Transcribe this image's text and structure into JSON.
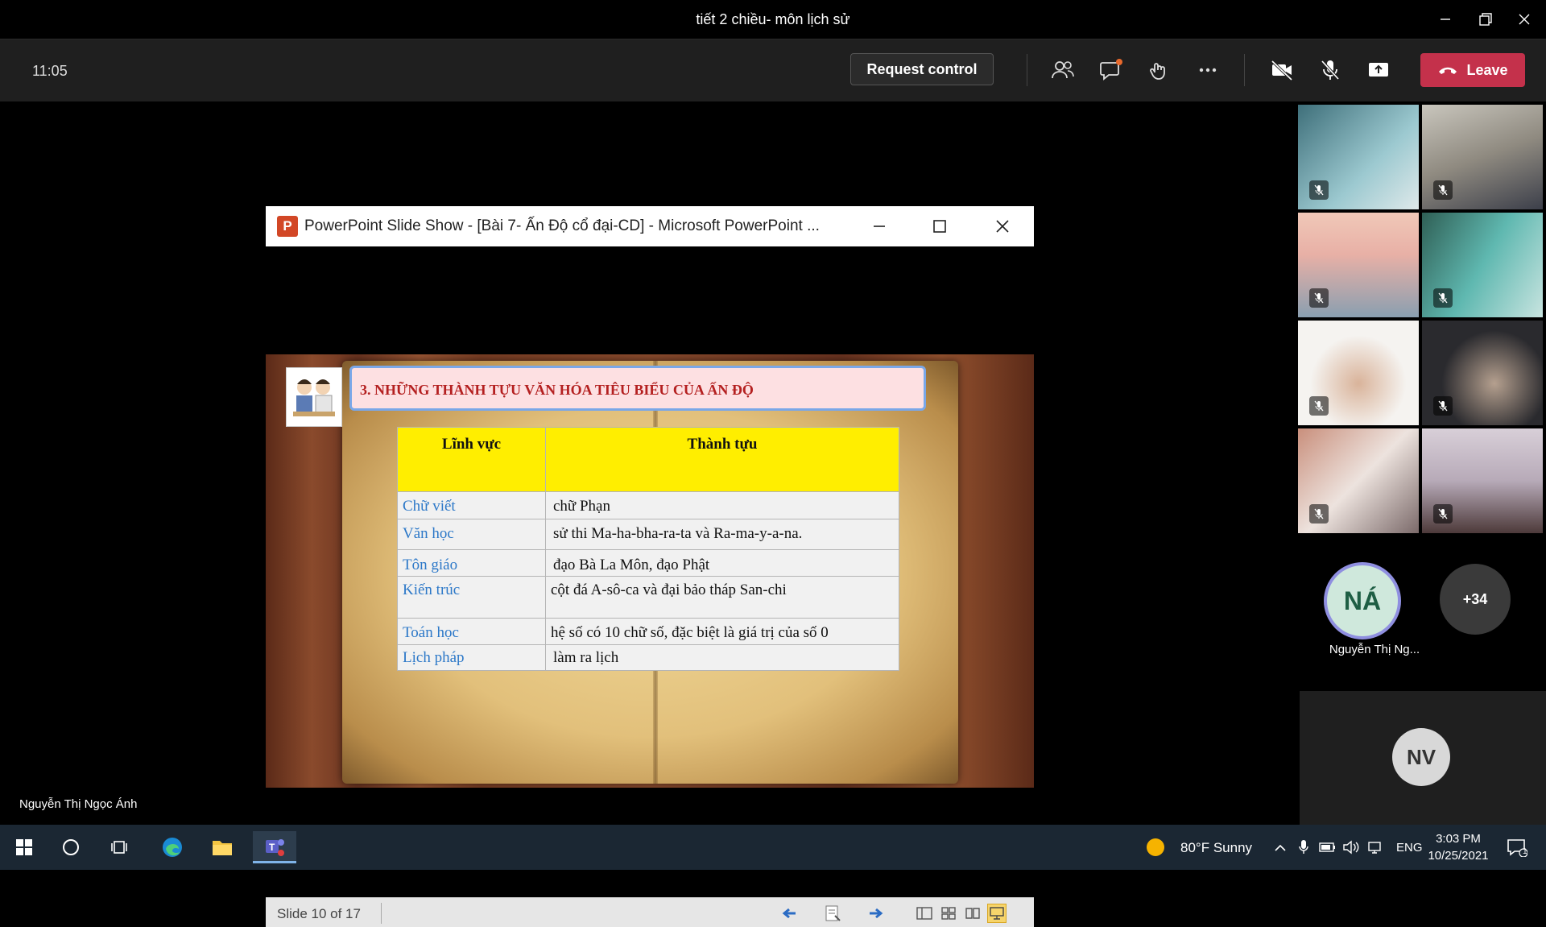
{
  "window": {
    "title": "tiết 2 chiều- môn lịch sử"
  },
  "meeting": {
    "clock": "11:05",
    "request_control_label": "Request control",
    "leave_label": "Leave",
    "toolbar_icons": [
      "participants-icon",
      "chat-icon",
      "reactions-icon",
      "more-options-icon",
      "camera-off-icon",
      "mic-off-icon",
      "share-screen-icon"
    ],
    "leave_color": "#c4314b"
  },
  "presenter_name": "Nguyễn Thị Ngọc Ánh",
  "powerpoint": {
    "title": "PowerPoint Slide Show - [Bài 7- Ấn Độ cổ đại-CD] - Microsoft PowerPoint ...",
    "logo_letter": "P",
    "status": {
      "slide_counter": "Slide 10 of 17"
    },
    "slide": {
      "heading": "3. NHỮNG THÀNH TỰU VĂN HÓA TIÊU BIỂU CỦA ẤN ĐỘ",
      "table": {
        "headers": [
          "Lĩnh vực",
          "Thành tựu"
        ],
        "rows": [
          {
            "field": "Chữ viết",
            "achievement": "chữ Phạn"
          },
          {
            "field": "Văn học",
            "achievement": "sử thi Ma-ha-bha-ra-ta và Ra-ma-y-a-na."
          },
          {
            "field": "Tôn giáo",
            "achievement": "đạo Bà La Môn, đạo Phật"
          },
          {
            "field": "Kiến trúc",
            "achievement": "cột đá A-sô-ca và đại bảo tháp San-chi"
          },
          {
            "field": "Toán học",
            "achievement": "hệ số có 10 chữ số, đặc biệt là giá trị của số 0"
          },
          {
            "field": "Lịch pháp",
            "achievement": "làm ra lịch"
          }
        ]
      }
    }
  },
  "participants": {
    "featured": {
      "initials": "NÁ",
      "name": "Nguyễn Thị Ng...",
      "color": "#cfe8dc"
    },
    "more_count": "+34",
    "bottom_avatar": {
      "initials": "NV",
      "color": "#d8d8d8"
    }
  },
  "taskbar": {
    "weather": "80°F  Sunny",
    "language": "ENG",
    "time": "3:03 PM",
    "date": "10/25/2021",
    "notification_count": "1"
  }
}
